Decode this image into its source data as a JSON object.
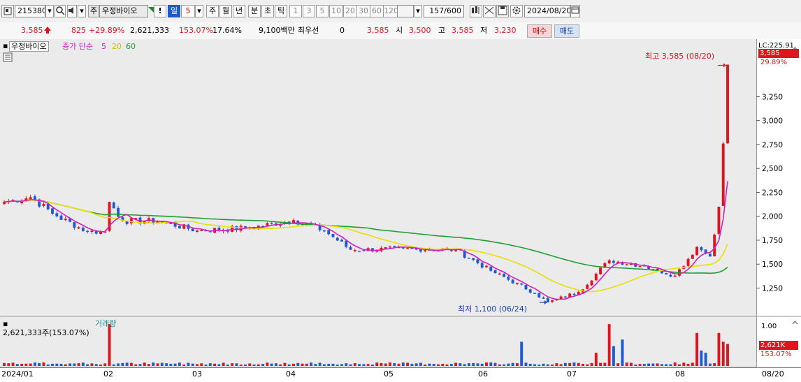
{
  "toolbar": {
    "stock_code": "215380",
    "stock_name": "우정바이오",
    "name_prefix": "주",
    "exclaim": "!",
    "period_selected": "일",
    "period_count": "5",
    "periods": [
      "주",
      "월",
      "년",
      "분",
      "초",
      "틱"
    ],
    "minute_options": [
      "1",
      "3",
      "5",
      "10",
      "20",
      "30",
      "60",
      "120"
    ],
    "count_display": "157/600",
    "date": "2024/08/20"
  },
  "quote": {
    "price": "3,585",
    "change": "825",
    "change_pct": "+29.89%",
    "volume": "2,621,333",
    "volume_ratio": "153.07%",
    "turnover": "17.64%",
    "amount": "9,100백만",
    "prio_label": "최우선",
    "prio_value": "0",
    "prio_price": "3,585",
    "open_label": "시",
    "open": "3,500",
    "high_label": "고",
    "high": "3,585",
    "low_label": "저",
    "low": "3,230",
    "buy_label": "매수",
    "sell_label": "매도"
  },
  "legend": {
    "name": "우정바이오",
    "ma_label": "종가 단순",
    "ma_periods": [
      "5",
      "20",
      "60"
    ]
  },
  "annotations": {
    "high_text": "최고 3,585 (08/20)",
    "low_text": "최저 1,100 (06/24)"
  },
  "axis_box": {
    "lc_label": "LC:225.91",
    "current_price": "3,585",
    "current_pct": "29.89%",
    "vol_current": "2,621K",
    "vol_pct": "153.07%"
  },
  "volume_panel": {
    "title": "거래량",
    "summary": "2,621,333주(153.07%)",
    "unit_label": "1.00"
  },
  "colors": {
    "up": "#e0141e",
    "down": "#1f5bd0",
    "ma5": "#d020c0",
    "ma20": "#e8e000",
    "ma60": "#22a030"
  },
  "chart_data": {
    "type": "candlestick",
    "price_axis": {
      "ticks": [
        "3,250",
        "3,000",
        "2,750",
        "2,500",
        "2,250",
        "2,000",
        "1,750",
        "1,500",
        "1,250"
      ],
      "range": [
        1020,
        3720
      ]
    },
    "date_axis": {
      "labels": [
        "2024/01",
        "02",
        "03",
        "04",
        "05",
        "06",
        "07",
        "08",
        "08/20"
      ]
    },
    "anchors": [
      {
        "date": "2024-01-02",
        "close": 2150
      },
      {
        "date": "2024-01-10",
        "close": 2200
      },
      {
        "date": "2024-01-18",
        "close": 2000
      },
      {
        "date": "2024-01-29",
        "close": 1840
      },
      {
        "date": "2024-02-02",
        "close": 1840
      },
      {
        "date": "2024-02-05",
        "close": 2150
      },
      {
        "date": "2024-02-08",
        "close": 1950
      },
      {
        "date": "2024-02-20",
        "close": 1950
      },
      {
        "date": "2024-03-04",
        "close": 1850
      },
      {
        "date": "2024-03-20",
        "close": 1880
      },
      {
        "date": "2024-04-03",
        "close": 1960
      },
      {
        "date": "2024-04-12",
        "close": 1850
      },
      {
        "date": "2024-04-22",
        "close": 1650
      },
      {
        "date": "2024-05-10",
        "close": 1660
      },
      {
        "date": "2024-05-24",
        "close": 1650
      },
      {
        "date": "2024-06-05",
        "close": 1430
      },
      {
        "date": "2024-06-19",
        "close": 1200
      },
      {
        "date": "2024-06-24",
        "close": 1100
      },
      {
        "date": "2024-07-03",
        "close": 1210
      },
      {
        "date": "2024-07-12",
        "close": 1540
      },
      {
        "date": "2024-07-24",
        "close": 1480
      },
      {
        "date": "2024-08-02",
        "close": 1380
      },
      {
        "date": "2024-08-09",
        "close": 1680
      },
      {
        "date": "2024-08-14",
        "close": 1580
      },
      {
        "date": "2024-08-16",
        "close": 2100
      },
      {
        "date": "2024-08-19",
        "close": 2760
      },
      {
        "date": "2024-08-20",
        "close": 3585
      }
    ],
    "high": {
      "date": "2024-08-20",
      "value": 3585
    },
    "low": {
      "date": "2024-06-24",
      "value": 1100
    }
  }
}
